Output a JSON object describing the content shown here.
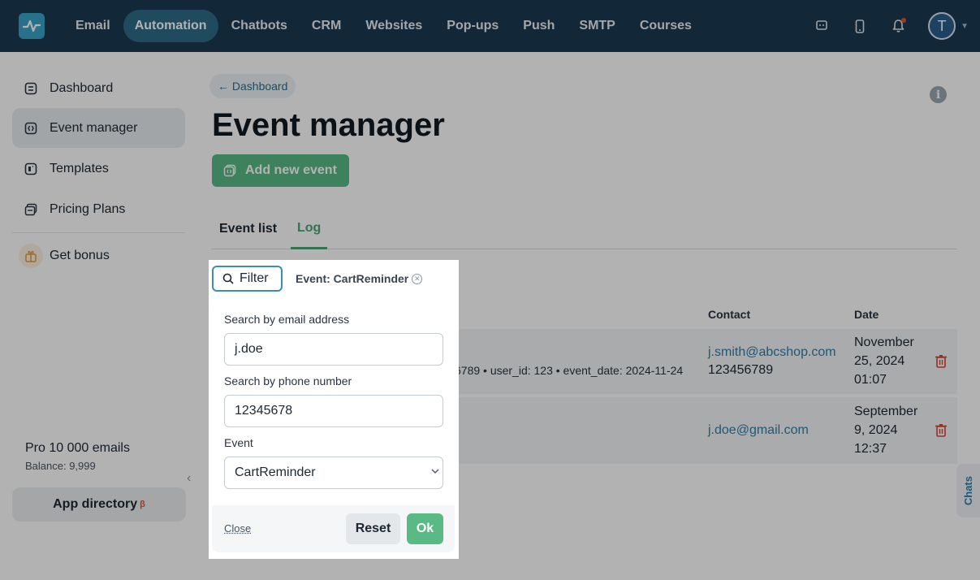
{
  "colors": {
    "topbar": "#1b3a52",
    "accent_green": "#5aba86",
    "link_blue": "#2f7fa8",
    "delete_red": "#d9442a"
  },
  "topbar": {
    "logo_icon": "pulse-logo-icon",
    "nav": [
      {
        "label": "Email",
        "active": false
      },
      {
        "label": "Automation",
        "active": true
      },
      {
        "label": "Chatbots",
        "active": false
      },
      {
        "label": "CRM",
        "active": false
      },
      {
        "label": "Websites",
        "active": false
      },
      {
        "label": "Pop-ups",
        "active": false
      },
      {
        "label": "Push",
        "active": false
      },
      {
        "label": "SMTP",
        "active": false
      },
      {
        "label": "Courses",
        "active": false
      }
    ],
    "icons": [
      "chat-icon",
      "mobile-icon",
      "bell-icon"
    ],
    "avatar_letter": "T"
  },
  "sidebar": {
    "items": [
      {
        "label": "Dashboard",
        "icon": "dashboard-icon",
        "active": false
      },
      {
        "label": "Event manager",
        "icon": "event-manager-icon",
        "active": true
      },
      {
        "label": "Templates",
        "icon": "templates-icon",
        "active": false
      },
      {
        "label": "Pricing Plans",
        "icon": "pricing-plans-icon",
        "active": false
      }
    ],
    "bonus_label": "Get bonus",
    "plan_name": "Pro 10 000 emails",
    "plan_balance": "Balance: 9,999",
    "app_directory": "App directory",
    "app_directory_badge": "β"
  },
  "main": {
    "breadcrumb": "← Dashboard",
    "title": "Event manager",
    "add_button": "Add new event",
    "tabs": [
      {
        "label": "Event list",
        "active": false
      },
      {
        "label": "Log",
        "active": true
      }
    ],
    "columns": {
      "contact": "Contact",
      "date": "Date"
    },
    "rows": [
      {
        "params": "6789 • user_id: 123 • event_date: 2024-11-24",
        "email": "j.smith@abcshop.com",
        "phone": "123456789",
        "date_line1": "November",
        "date_line2": "25, 2024",
        "date_line3": "01:07"
      },
      {
        "params": "",
        "email": "j.doe@gmail.com",
        "phone": "",
        "date_line1": "September",
        "date_line2": "9, 2024",
        "date_line3": "12:37"
      }
    ],
    "chats_tab": "Chats"
  },
  "filter": {
    "button_label": "Filter",
    "active_chip": "Event: CartReminder",
    "email_label": "Search by email address",
    "email_value": "j.doe",
    "phone_label": "Search by phone number",
    "phone_value": "12345678",
    "event_label": "Event",
    "event_value": "CartReminder",
    "close_label": "Close",
    "reset_label": "Reset",
    "ok_label": "Ok"
  }
}
